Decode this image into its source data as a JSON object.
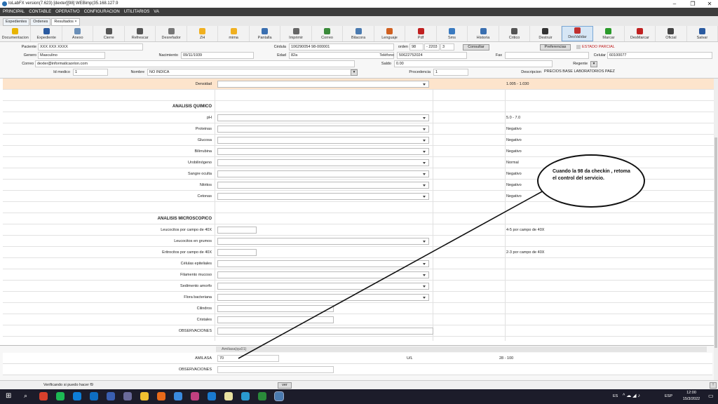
{
  "window": {
    "title": "IoLabFX version(7.623)  [dexter][98] WEBimp(35.168.127.9"
  },
  "menu": [
    "PRINCIPAL",
    "CONTABLE",
    "OPERATIVO",
    "CONFIGURACION",
    "UTILITARIOS",
    "VA"
  ],
  "tabs": [
    "Expedientes",
    "Ordenes",
    "Resultados ×"
  ],
  "toolbar": [
    {
      "label": "Documentacion",
      "icon": "document-icon",
      "color": "#e8b400"
    },
    {
      "label": "Expediente",
      "icon": "user-icon",
      "color": "#2a5aa0"
    },
    {
      "label": "Anexo",
      "icon": "attach-icon",
      "color": "#6a8fb8"
    },
    {
      "label": "Cierre",
      "icon": "lock-icon",
      "color": "#555555"
    },
    {
      "label": "Refrescar",
      "icon": "refresh-icon",
      "color": "#555555"
    },
    {
      "label": "Desrefador",
      "icon": "edit-icon",
      "color": "#777777"
    },
    {
      "label": "ZH",
      "icon": "star-icon",
      "color": "#f0b020"
    },
    {
      "label": "mima",
      "icon": "star-icon",
      "color": "#f0b020"
    },
    {
      "label": "Pantalla",
      "icon": "monitor-icon",
      "color": "#3a6fb0"
    },
    {
      "label": "Imprimir",
      "icon": "printer-icon",
      "color": "#666666"
    },
    {
      "label": "Correo",
      "icon": "mail-icon",
      "color": "#3a8a3a"
    },
    {
      "label": "Bitacora",
      "icon": "search-icon",
      "color": "#4a7ab0"
    },
    {
      "label": "Lenguaje",
      "icon": "palette-icon",
      "color": "#d06020"
    },
    {
      "label": "Pdf",
      "icon": "pdf-icon",
      "color": "#c02020"
    },
    {
      "label": "Sms",
      "icon": "sms-icon",
      "color": "#3a7ac0"
    },
    {
      "label": "Historia",
      "icon": "history-icon",
      "color": "#3a6fb0"
    },
    {
      "label": "Critico",
      "icon": "alert-icon",
      "color": "#555555"
    },
    {
      "label": "Destruir",
      "icon": "destroy-icon",
      "color": "#333333"
    },
    {
      "label": "DesValidar",
      "icon": "unvalidate-icon",
      "color": "#c03030"
    },
    {
      "label": "Marcar",
      "icon": "check-icon",
      "color": "#2a9a2a"
    },
    {
      "label": "DesMarcar",
      "icon": "uncheck-icon",
      "color": "#c02020"
    },
    {
      "label": "Oficial",
      "icon": "pen-icon",
      "color": "#444444"
    },
    {
      "label": "Salvar",
      "icon": "save-icon",
      "color": "#2a5aa0"
    }
  ],
  "patient": {
    "paciente_label": "Paciente",
    "paciente": "XXX XXX XXXX",
    "cedula_label": "Cédula",
    "cedula": "106290054  98-000001",
    "orden_label": "orden",
    "orden_1": "98",
    "orden_2": "- 2203",
    "orden_3": "3",
    "consultar": "Consultar",
    "preferencias": "Preferencias",
    "estado": "ESTADO PARCIAL",
    "genero_label": "Genero",
    "genero": "Masculino",
    "nacimiento_label": "Nacimiento",
    "nacimiento": "09/11/1939",
    "edad_label": "Edad",
    "edad": "82a",
    "telefono_label": "Teléfono",
    "telefono": "50622752024",
    "fax_label": "Fax",
    "celular_label": "Celular",
    "celular": "60100077",
    "correo_label": "Correo",
    "correo": "dexter@informaticaorion.com",
    "saldo_label": "Saldo",
    "saldo": "0.00",
    "regente_label": "Regente",
    "idmedico_label": "Id medico",
    "idmedico": "1",
    "nombre_label": "Nombre",
    "nombre": "NO INDICA",
    "procedencia_label": "Procedencia",
    "procedencia": "1",
    "descripcion_label": "Descripcion",
    "descripcion": "PRECIOS BASE LABORATORIOS PAEZ"
  },
  "rows": [
    {
      "label": "Densidad",
      "ctrl": "dd",
      "ref": "1.005 - 1.030",
      "hl": true
    },
    {
      "label": "",
      "ctrl": "",
      "ref": ""
    },
    {
      "label": "ANALISIS QUIMICO",
      "ctrl": "",
      "ref": "",
      "sec": true
    },
    {
      "label": "pH",
      "ctrl": "dd",
      "ref": "5.0 - 7.0"
    },
    {
      "label": "Proteinas",
      "ctrl": "dd",
      "ref": "Negativo"
    },
    {
      "label": "Glucosa",
      "ctrl": "dd",
      "ref": "Negativo"
    },
    {
      "label": "Bilirrubina",
      "ctrl": "dd",
      "ref": "Negativo"
    },
    {
      "label": "Urobilinógeno",
      "ctrl": "dd",
      "ref": "Normal"
    },
    {
      "label": "Sangre oculta",
      "ctrl": "dd",
      "ref": "Negativo"
    },
    {
      "label": "Nitritos",
      "ctrl": "dd",
      "ref": "Negativo"
    },
    {
      "label": "Cetonas",
      "ctrl": "dd",
      "ref": "Negativo"
    },
    {
      "label": "",
      "ctrl": "",
      "ref": ""
    },
    {
      "label": "ANALISIS MICROSCOPICO",
      "ctrl": "",
      "ref": "",
      "sec": true
    },
    {
      "label": "Leucocitos por campo de 40X",
      "ctrl": "tx",
      "ref": "4-5 por campo de 40X"
    },
    {
      "label": "Leucocitos en grumos",
      "ctrl": "dd",
      "ref": ""
    },
    {
      "label": "Eritrocitos por campo de 40X",
      "ctrl": "tx",
      "ref": "2-3 por campo de 40X"
    },
    {
      "label": "Células epiteliales",
      "ctrl": "dd",
      "ref": ""
    },
    {
      "label": "Filamento mucoso",
      "ctrl": "dd",
      "ref": ""
    },
    {
      "label": "Sedimento amorfo",
      "ctrl": "dd",
      "ref": ""
    },
    {
      "label": "Flora bacteriana",
      "ctrl": "dd",
      "ref": ""
    },
    {
      "label": "Cilindros",
      "ctrl": "txl",
      "ref": ""
    },
    {
      "label": "Cristales",
      "ctrl": "txl",
      "ref": ""
    },
    {
      "label": "OBSERVACIONES",
      "ctrl": "txw",
      "ref": ""
    }
  ],
  "amilasa": {
    "header": "Amilasa(qu01)",
    "label": "AMILASA",
    "value": "70",
    "unit": "U/L",
    "ref": "28 - 100",
    "obs_label": "OBSERVACIONES"
  },
  "callout": {
    "text": "Cuando la 98 da checkin , retoma el control del servicio."
  },
  "status": {
    "text": "Verificando si puedo hacer f9",
    "ver": "ver"
  },
  "taskbar": {
    "lang": "ES",
    "sys": "ESP",
    "time": "12:00",
    "date": "15/3/2022"
  }
}
